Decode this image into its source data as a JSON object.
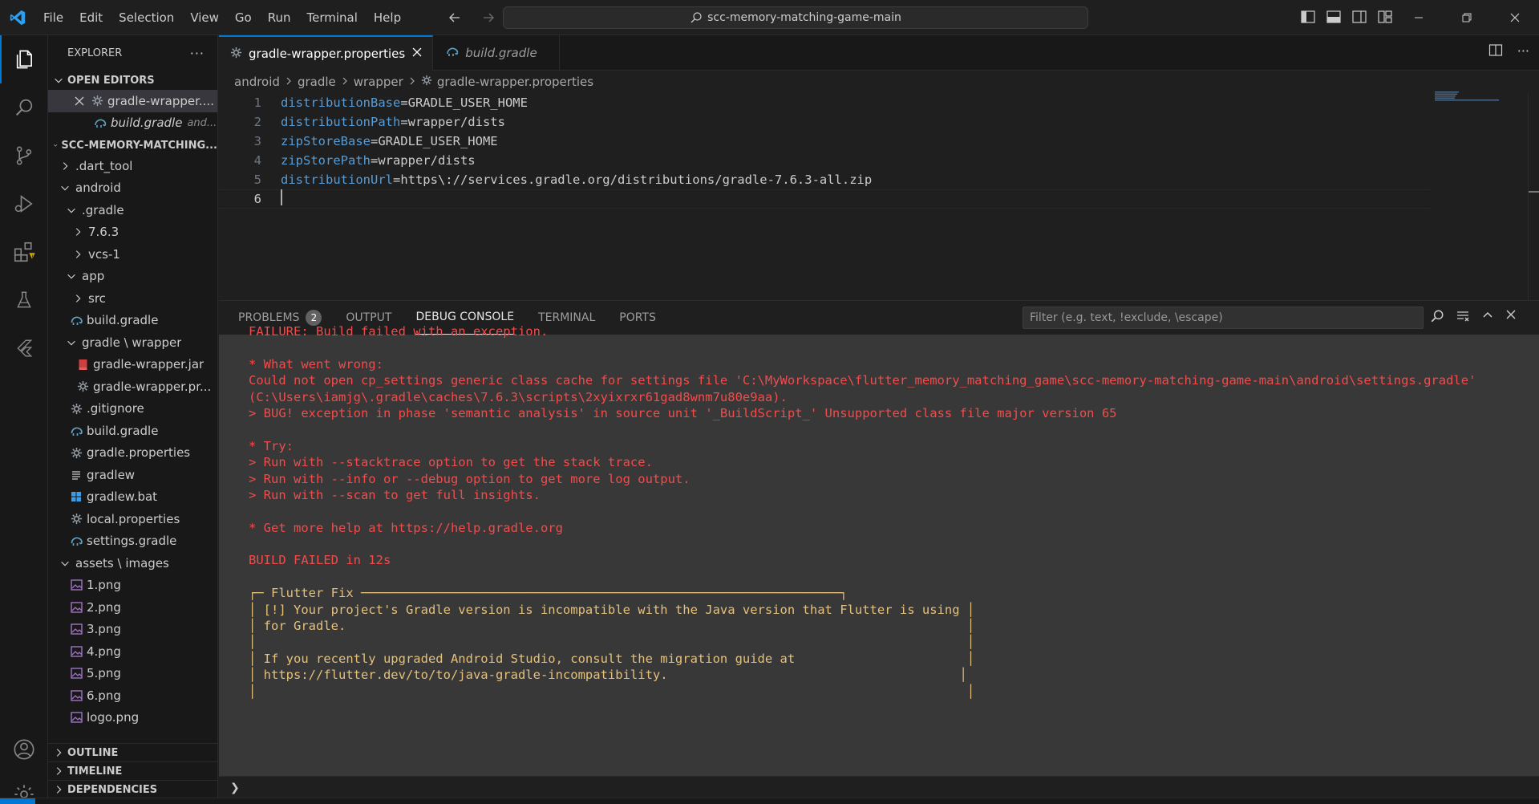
{
  "menu": [
    "File",
    "Edit",
    "Selection",
    "View",
    "Go",
    "Run",
    "Terminal",
    "Help"
  ],
  "search": {
    "text": "scc-memory-matching-game-main"
  },
  "colors": {
    "accent": "#0078d4",
    "keyword": "#569cd6",
    "error": "#f14c4c",
    "warning": "#e5c07b"
  },
  "sidebar": {
    "title": "EXPLORER",
    "open_editors_label": "OPEN EDITORS",
    "open_editors": [
      {
        "label": "gradle-wrapper....",
        "icon": "gear-icon",
        "close": true
      },
      {
        "label": "build.gradle",
        "extra": "and...",
        "icon": "gradle-elephant-icon"
      }
    ],
    "project_label": "SCC-MEMORY-MATCHING...",
    "tree": [
      {
        "label": ".dart_tool",
        "indent": 1,
        "chev": "right"
      },
      {
        "label": "android",
        "indent": 1,
        "chev": "down"
      },
      {
        "label": ".gradle",
        "indent": 2,
        "chev": "down"
      },
      {
        "label": "7.6.3",
        "indent": 3,
        "chev": "right"
      },
      {
        "label": "vcs-1",
        "indent": 3,
        "chev": "right"
      },
      {
        "label": "app",
        "indent": 2,
        "chev": "down"
      },
      {
        "label": "src",
        "indent": 3,
        "chev": "right"
      },
      {
        "label": "build.gradle",
        "indent": 2,
        "icon": "gradle"
      },
      {
        "label": "gradle \\ wrapper",
        "indent": 2,
        "chev": "down"
      },
      {
        "label": "gradle-wrapper.jar",
        "indent": 3,
        "icon": "jar"
      },
      {
        "label": "gradle-wrapper.pr...",
        "indent": 3,
        "icon": "gear"
      },
      {
        "label": ".gitignore",
        "indent": 2,
        "icon": "gear"
      },
      {
        "label": "build.gradle",
        "indent": 2,
        "icon": "gradle"
      },
      {
        "label": "gradle.properties",
        "indent": 2,
        "icon": "gear"
      },
      {
        "label": "gradlew",
        "indent": 2,
        "icon": "lines"
      },
      {
        "label": "gradlew.bat",
        "indent": 2,
        "icon": "windows"
      },
      {
        "label": "local.properties",
        "indent": 2,
        "icon": "gear"
      },
      {
        "label": "settings.gradle",
        "indent": 2,
        "icon": "gradle"
      },
      {
        "label": "assets \\ images",
        "indent": 1,
        "chev": "down"
      },
      {
        "label": "1.png",
        "indent": 2,
        "icon": "image"
      },
      {
        "label": "2.png",
        "indent": 2,
        "icon": "image"
      },
      {
        "label": "3.png",
        "indent": 2,
        "icon": "image"
      },
      {
        "label": "4.png",
        "indent": 2,
        "icon": "image"
      },
      {
        "label": "5.png",
        "indent": 2,
        "icon": "image"
      },
      {
        "label": "6.png",
        "indent": 2,
        "icon": "image"
      },
      {
        "label": "logo.png",
        "indent": 2,
        "icon": "image"
      }
    ],
    "outline_label": "OUTLINE",
    "timeline_label": "TIMELINE",
    "dependencies_label": "DEPENDENCIES"
  },
  "editor": {
    "tabs": [
      {
        "label": "gradle-wrapper.properties",
        "active": true,
        "icon": "gear-icon"
      },
      {
        "label": "build.gradle",
        "active": false,
        "icon": "gradle-elephant-icon"
      }
    ],
    "breadcrumb": [
      "android",
      "gradle",
      "wrapper",
      "gradle-wrapper.properties"
    ],
    "lines": [
      {
        "num": "1",
        "key": "distributionBase",
        "val": "=GRADLE_USER_HOME"
      },
      {
        "num": "2",
        "key": "distributionPath",
        "val": "=wrapper/dists"
      },
      {
        "num": "3",
        "key": "zipStoreBase",
        "val": "=GRADLE_USER_HOME"
      },
      {
        "num": "4",
        "key": "zipStorePath",
        "val": "=wrapper/dists"
      },
      {
        "num": "5",
        "key": "distributionUrl",
        "val": "=https\\://services.gradle.org/distributions/gradle-7.6.3-all.zip"
      },
      {
        "num": "6",
        "key": "",
        "val": ""
      }
    ]
  },
  "panel": {
    "tabs": [
      {
        "label": "PROBLEMS",
        "badge": "2"
      },
      {
        "label": "OUTPUT"
      },
      {
        "label": "DEBUG CONSOLE",
        "active": true
      },
      {
        "label": "TERMINAL"
      },
      {
        "label": "PORTS"
      }
    ],
    "filter_placeholder": "Filter (e.g. text, !exclude, \\escape)",
    "console_lines": [
      {
        "text": "FAILURE: Build failed with an exception.",
        "style": "err"
      },
      {
        "text": "",
        "style": "err"
      },
      {
        "text": "* What went wrong:",
        "style": "err"
      },
      {
        "text": "Could not open cp_settings generic class cache for settings file 'C:\\MyWorkspace\\flutter_memory_matching_game\\scc-memory-matching-game-main\\android\\settings.gradle'",
        "style": "err"
      },
      {
        "text": "(C:\\Users\\iamjg\\.gradle\\caches\\7.6.3\\scripts\\2xyixrxr61gad8wnm7u80e9aa).",
        "style": "err"
      },
      {
        "text": "> BUG! exception in phase 'semantic analysis' in source unit '_BuildScript_' Unsupported class file major version 65",
        "style": "err"
      },
      {
        "text": "",
        "style": "err"
      },
      {
        "text": "* Try:",
        "style": "err"
      },
      {
        "text": "> Run with --stacktrace option to get the stack trace.",
        "style": "err"
      },
      {
        "text": "> Run with --info or --debug option to get more log output.",
        "style": "err"
      },
      {
        "text": "> Run with --scan to get full insights.",
        "style": "err"
      },
      {
        "text": "",
        "style": "err"
      },
      {
        "text": "* Get more help at https://help.gradle.org",
        "style": "err"
      },
      {
        "text": "",
        "style": "err"
      },
      {
        "text": "BUILD FAILED in 12s",
        "style": "err"
      },
      {
        "text": "",
        "style": "err"
      },
      {
        "text": "┌─ Flutter Fix ────────────────────────────────────────────────────────────────┐",
        "style": "yel"
      },
      {
        "text": "│ [!] Your project's Gradle version is incompatible with the Java version that Flutter is using │",
        "style": "yel"
      },
      {
        "text": "│ for Gradle.                                                                                   │",
        "style": "yel"
      },
      {
        "text": "│                                                                                               │",
        "style": "yel"
      },
      {
        "text": "│ If you recently upgraded Android Studio, consult the migration guide at                       │",
        "style": "yel"
      },
      {
        "text": "│ https://flutter.dev/to/to/java-gradle-incompatibility.                                       │",
        "style": "yel"
      },
      {
        "text": "│                                                                                               │",
        "style": "yel"
      }
    ],
    "prompt_symbol": "❯"
  }
}
